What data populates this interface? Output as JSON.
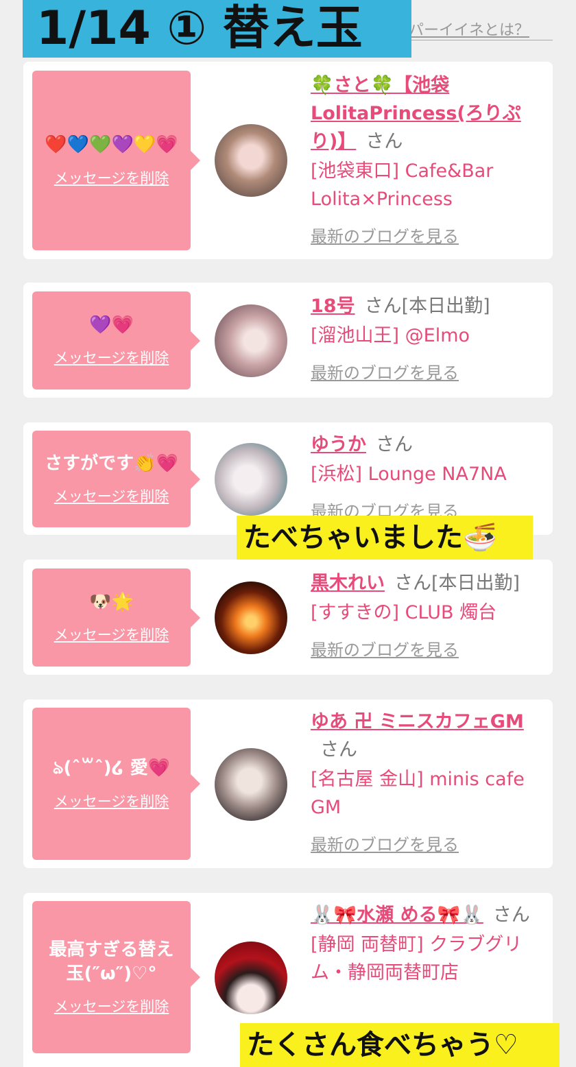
{
  "header": {
    "title": "1/14 ① 替え玉",
    "help_link": "パーイイネとは？"
  },
  "delete_label": "メッセージを削除",
  "blog_label": "最新のブログを見る",
  "san_label": "さん",
  "cards": [
    {
      "message": "❤️💙💚💜💛💗",
      "name": "🍀さと🍀【池袋LolitaPrincess(ろりぷり)】",
      "suffix": "",
      "location": "[池袋東口] Cafe&Bar Lolita×Princess"
    },
    {
      "message": "💜💗",
      "name": "18号",
      "suffix": "[本日出勤]",
      "location": "[溜池山王] @Elmo"
    },
    {
      "message": "さすがです👏💗",
      "name": "ゆうか",
      "suffix": "",
      "location": "[浜松] Lounge NA7NA"
    },
    {
      "message": "🐶🌟",
      "name": "黒木れい",
      "suffix": "[本日出勤]",
      "location": "[すすきの] CLUB 燭台"
    },
    {
      "message": "ঌ(ˆ꒳ˆ)໒ 愛💗",
      "name": "ゆあ 卍 ミニスカフェGM",
      "suffix": "",
      "location": "[名古屋 金山] minis cafe GM"
    },
    {
      "message": "最高すぎる替え玉(″ω″)♡°",
      "name": "🐰🎀水瀬 める🎀🐰",
      "suffix": "",
      "location": "[静岡 両替町] クラブグリム・静岡両替町店"
    }
  ],
  "captions": {
    "first": "たべちゃいました🍜",
    "second": "たくさん食べちゃう♡"
  },
  "colors": {
    "banner": "#37b3dc",
    "bubble": "#fa97a6",
    "link": "#e64b79",
    "caption": "#faf01e"
  }
}
